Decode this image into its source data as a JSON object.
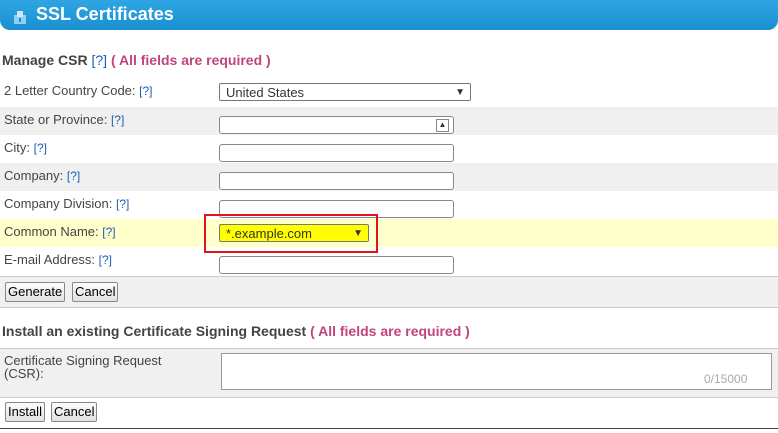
{
  "header": {
    "title": "SSL Certificates"
  },
  "manage": {
    "title": "Manage CSR",
    "help": "[?]",
    "required": "( All fields are required )",
    "fields": [
      {
        "label": "2 Letter Country Code:",
        "help": "[?]",
        "value": "United States"
      },
      {
        "label": "State or Province:",
        "help": "[?]",
        "value": ""
      },
      {
        "label": "City:",
        "help": "[?]",
        "value": ""
      },
      {
        "label": "Company:",
        "help": "[?]",
        "value": ""
      },
      {
        "label": "Company Division:",
        "help": "[?]",
        "value": ""
      },
      {
        "label": "Common Name:",
        "help": "[?]",
        "value": "*.example.com"
      },
      {
        "label": "E-mail Address:",
        "help": "[?]",
        "value": ""
      }
    ],
    "generate_label": "Generate",
    "cancel_label": "Cancel"
  },
  "install": {
    "title": "Install an existing Certificate Signing Request",
    "required": "( All fields are required )",
    "csr_label": "Certificate Signing Request (CSR):",
    "counter": "0/15000",
    "install_label": "Install",
    "cancel_label": "Cancel"
  },
  "colors": {
    "header": "#1a8fd0",
    "required": "#c0457a",
    "highlight": "#ffffcc",
    "callout": "#e0141d"
  },
  "icons": {
    "header": "ssl-cert-icon"
  }
}
